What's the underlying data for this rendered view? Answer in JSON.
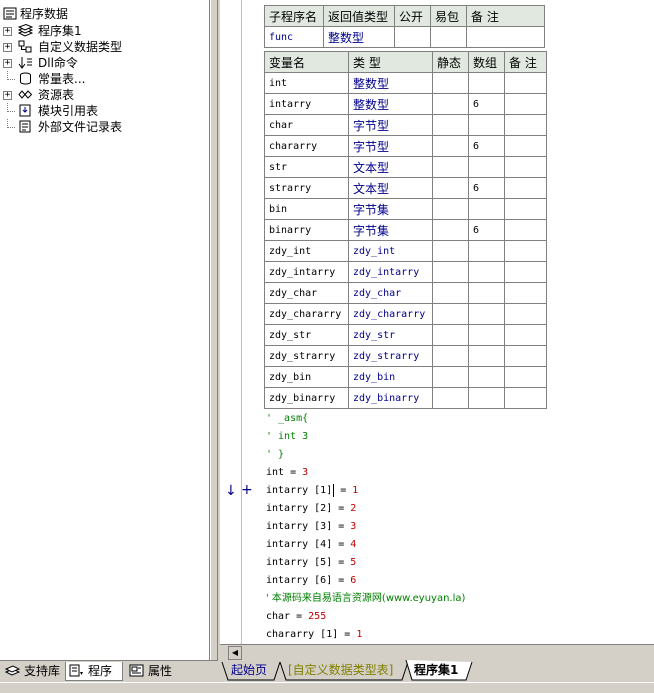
{
  "tree": {
    "root": "程序数据",
    "items": [
      {
        "label": "程序集1",
        "icon": "stack-icon",
        "expander": "+"
      },
      {
        "label": "自定义数据类型",
        "icon": "datatype-icon",
        "expander": "+"
      },
      {
        "label": "Dll命令",
        "icon": "dll-icon",
        "expander": "+"
      },
      {
        "label": "常量表...",
        "icon": "constant-icon",
        "expander": ""
      },
      {
        "label": "资源表",
        "icon": "resource-icon",
        "expander": "+"
      },
      {
        "label": "模块引用表",
        "icon": "module-icon",
        "expander": ""
      },
      {
        "label": "外部文件记录表",
        "icon": "file-icon",
        "expander": ""
      }
    ]
  },
  "left_tabs": [
    "支持库",
    "程序",
    "属性"
  ],
  "sub_table": {
    "headers": [
      "子程序名",
      "返回值类型",
      "公开",
      "易包",
      "备 注"
    ],
    "row": {
      "name": "func",
      "return_type": "整数型",
      "public": "",
      "easy_pkg": "",
      "note": ""
    }
  },
  "var_table": {
    "headers": [
      "变量名",
      "类 型",
      "静态",
      "数组",
      "备 注"
    ],
    "rows": [
      {
        "name": "int",
        "type": "整数型",
        "static": "",
        "array": "",
        "note": ""
      },
      {
        "name": "intarry",
        "type": "整数型",
        "static": "",
        "array": "6",
        "note": ""
      },
      {
        "name": "char",
        "type": "字节型",
        "static": "",
        "array": "",
        "note": ""
      },
      {
        "name": "chararry",
        "type": "字节型",
        "static": "",
        "array": "6",
        "note": ""
      },
      {
        "name": "str",
        "type": "文本型",
        "static": "",
        "array": "",
        "note": ""
      },
      {
        "name": "strarry",
        "type": "文本型",
        "static": "",
        "array": "6",
        "note": ""
      },
      {
        "name": "bin",
        "type": "字节集",
        "static": "",
        "array": "",
        "note": ""
      },
      {
        "name": "binarry",
        "type": "字节集",
        "static": "",
        "array": "6",
        "note": ""
      },
      {
        "name": "zdy_int",
        "type": "zdy_int",
        "static": "",
        "array": "",
        "note": ""
      },
      {
        "name": "zdy_intarry",
        "type": "zdy_intarry",
        "static": "",
        "array": "",
        "note": ""
      },
      {
        "name": "zdy_char",
        "type": "zdy_char",
        "static": "",
        "array": "",
        "note": ""
      },
      {
        "name": "zdy_chararry",
        "type": "zdy_chararry",
        "static": "",
        "array": "",
        "note": ""
      },
      {
        "name": "zdy_str",
        "type": "zdy_str",
        "static": "",
        "array": "",
        "note": ""
      },
      {
        "name": "zdy_strarry",
        "type": "zdy_strarry",
        "static": "",
        "array": "",
        "note": ""
      },
      {
        "name": "zdy_bin",
        "type": "zdy_bin",
        "static": "",
        "array": "",
        "note": ""
      },
      {
        "name": "zdy_binarry",
        "type": "zdy_binarry",
        "static": "",
        "array": "",
        "note": ""
      }
    ]
  },
  "code": {
    "lines": [
      {
        "kind": "comment",
        "text": "' _asm{"
      },
      {
        "kind": "comment",
        "text": "' int 3"
      },
      {
        "kind": "comment",
        "text": "' }"
      },
      {
        "kind": "assign",
        "lhs": "int",
        "op": " = ",
        "rhs": "3"
      },
      {
        "kind": "assign",
        "lhs": "intarry [1]",
        "op": " = ",
        "rhs": "1",
        "cursor": true
      },
      {
        "kind": "assign",
        "lhs": "intarry [2]",
        "op": " = ",
        "rhs": "2"
      },
      {
        "kind": "assign",
        "lhs": "intarry [3]",
        "op": " = ",
        "rhs": "3"
      },
      {
        "kind": "assign",
        "lhs": "intarry [4]",
        "op": " = ",
        "rhs": "4"
      },
      {
        "kind": "assign",
        "lhs": "intarry [5]",
        "op": " = ",
        "rhs": "5"
      },
      {
        "kind": "assign",
        "lhs": "intarry [6]",
        "op": " = ",
        "rhs": "6"
      },
      {
        "kind": "comment",
        "text": "' 本源码来自易语言资源网(www.eyuyan.la)"
      },
      {
        "kind": "assign",
        "lhs": "char",
        "op": " = ",
        "rhs": "255"
      },
      {
        "kind": "assign",
        "lhs": "chararry [1]",
        "op": " = ",
        "rhs": "1"
      }
    ],
    "markers": {
      "arrow": "↓",
      "plus": "+"
    }
  },
  "right_tabs": [
    {
      "label": "起始页",
      "color": "#00008b",
      "active": false
    },
    {
      "label": "[自定义数据类型表]",
      "color": "#808000",
      "active": false
    },
    {
      "label": "程序集1",
      "color": "#000000",
      "active": true
    }
  ]
}
